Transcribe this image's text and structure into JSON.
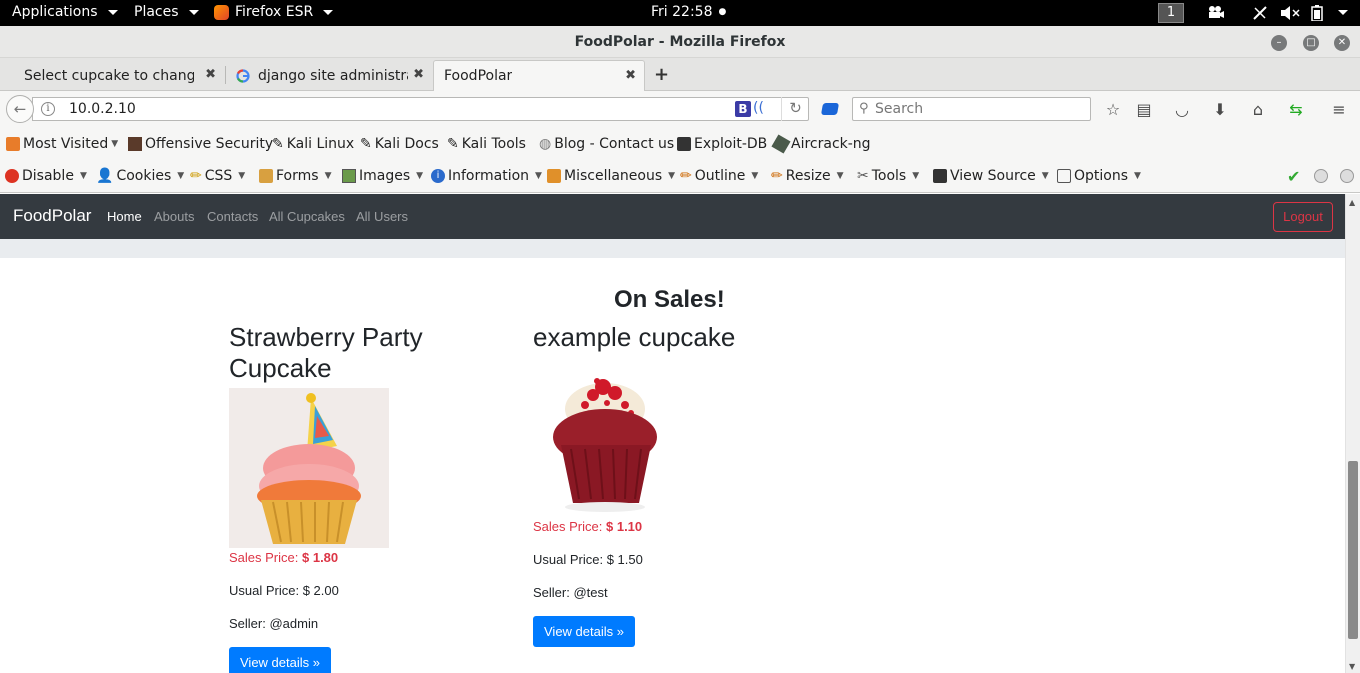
{
  "topbar": {
    "applications": "Applications",
    "places": "Places",
    "firefox": "Firefox ESR",
    "clock": "Fri 22:58",
    "workspace": "1"
  },
  "window": {
    "title": "FoodPolar - Mozilla Firefox"
  },
  "tabs": [
    {
      "label": "Select cupcake to chang..."
    },
    {
      "label": "django site administra..."
    },
    {
      "label": "FoodPolar"
    }
  ],
  "navbar": {
    "url": "10.0.2.10",
    "search_placeholder": "Search"
  },
  "bookmarks": [
    {
      "label": "Most Visited",
      "icon": "most-visited-icon"
    },
    {
      "label": "Offensive Security",
      "icon": "offsec-icon"
    },
    {
      "label": "Kali Linux",
      "icon": "kali-icon"
    },
    {
      "label": "Kali Docs",
      "icon": "kali-icon"
    },
    {
      "label": "Kali Tools",
      "icon": "kali-icon"
    },
    {
      "label": "Blog - Contact us",
      "icon": "globe-icon"
    },
    {
      "label": "Exploit-DB",
      "icon": "exploitdb-icon"
    },
    {
      "label": "Aircrack-ng",
      "icon": "aircrack-icon"
    }
  ],
  "webdev": [
    {
      "label": "Disable"
    },
    {
      "label": "Cookies"
    },
    {
      "label": "CSS"
    },
    {
      "label": "Forms"
    },
    {
      "label": "Images"
    },
    {
      "label": "Information"
    },
    {
      "label": "Miscellaneous"
    },
    {
      "label": "Outline"
    },
    {
      "label": "Resize"
    },
    {
      "label": "Tools"
    },
    {
      "label": "View Source"
    },
    {
      "label": "Options"
    }
  ],
  "site": {
    "brand": "FoodPolar",
    "nav": [
      "Home",
      "Abouts",
      "Contacts",
      "All Cupcakes",
      "All Users"
    ],
    "logout": "Logout",
    "section_title": "On Sales!",
    "colors": {
      "navbar": "#343a40",
      "primary": "#007bff",
      "danger": "#dc3545"
    }
  },
  "cupcakes": [
    {
      "name": "Strawberry Party Cupcake",
      "sales_label": "Sales Price:",
      "sales_price": "$ 1.80",
      "usual_price": "Usual Price: $ 2.00",
      "seller": "Seller: @admin",
      "button": "View details »"
    },
    {
      "name": "example cupcake",
      "sales_label": "Sales Price:",
      "sales_price": "$ 1.10",
      "usual_price": "Usual Price: $ 1.50",
      "seller": "Seller: @test",
      "button": "View details »"
    }
  ]
}
